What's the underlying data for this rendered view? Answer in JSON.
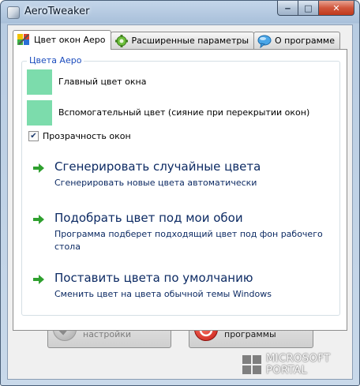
{
  "window": {
    "title": "AeroTweaker"
  },
  "caption": {
    "minimize": "‒",
    "maximize": "□",
    "close": "✕"
  },
  "tabs": [
    {
      "label": "Цвет окон Аеро",
      "icon": "color-palette-icon",
      "active": true
    },
    {
      "label": "Расширенные параметры",
      "icon": "gear-icon",
      "active": false
    },
    {
      "label": "О программе",
      "icon": "speech-bubble-icon",
      "active": false
    }
  ],
  "aero": {
    "group_label": "Цвета Аеро",
    "main_color_label": "Главный цвет окна",
    "secondary_color_label": "Вспомогательный цвет (сияние при перекрытии окон)",
    "main_color": "#7cdcac",
    "secondary_color": "#7cdcac",
    "transparency_label": "Прозрачность окон",
    "transparency_checked": true,
    "check_mark": "✔"
  },
  "commands": [
    {
      "title": "Сгенерировать случайные цвета",
      "description": "Сгенерировать новые цвета автоматически"
    },
    {
      "title": "Подобрать цвет под мои обои",
      "description": "Программа подберет подходящий цвет под фон рабочего стола"
    },
    {
      "title": "Поставить цвета по умолчанию",
      "description": "Сменить цвет на цвета обычной темы Windows"
    }
  ],
  "buttons": {
    "save_label": "Сохранить настройки",
    "exit_label": "Выход из программы"
  },
  "watermark": {
    "line1": "MICROSOFT",
    "line2": "PORTAL"
  }
}
